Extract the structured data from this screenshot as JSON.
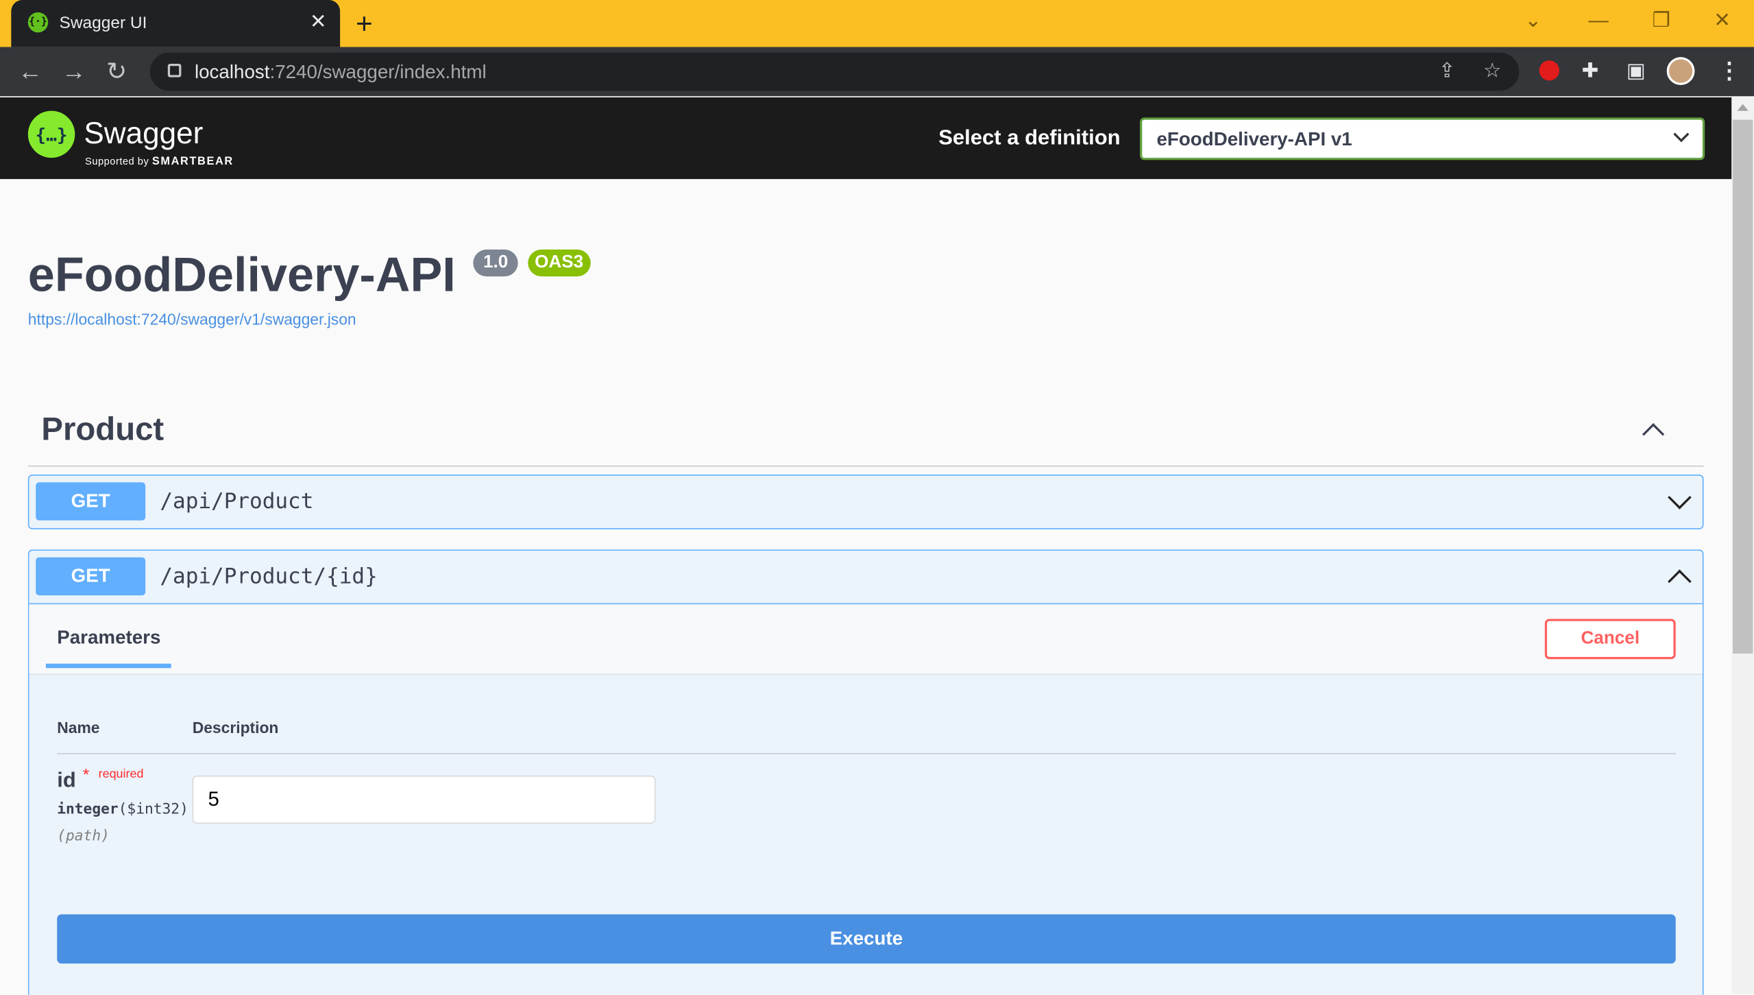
{
  "browser": {
    "tab_title": "Swagger UI",
    "url_host": "localhost",
    "url_rest": ":7240/swagger/index.html"
  },
  "topbar": {
    "brand": "Swagger",
    "supported_by": "Supported by",
    "supported_brand": "SMARTBEAR",
    "definition_label": "Select a definition",
    "definition_value": "eFoodDelivery-API v1"
  },
  "info": {
    "title": "eFoodDelivery-API",
    "version": "1.0",
    "oas": "OAS3",
    "spec_url": "https://localhost:7240/swagger/v1/swagger.json"
  },
  "tag": {
    "name": "Product"
  },
  "operations": [
    {
      "method": "GET",
      "path": "/api/Product",
      "expanded": false
    },
    {
      "method": "GET",
      "path": "/api/Product/{id}",
      "expanded": true
    }
  ],
  "try_panel": {
    "parameters_tab": "Parameters",
    "cancel_label": "Cancel",
    "col_name": "Name",
    "col_description": "Description",
    "param": {
      "name": "id",
      "required_star": "*",
      "required_label": "required",
      "type": "integer",
      "format": "($int32)",
      "in": "(path)",
      "value": "5"
    },
    "execute_label": "Execute"
  },
  "colors": {
    "get_blue": "#61affe",
    "execute_blue": "#4990e2",
    "cancel_red": "#ff6060",
    "brand_green": "#85ea2d",
    "oas_green": "#89bf04",
    "tabstrip_yellow": "#fbbf24"
  }
}
